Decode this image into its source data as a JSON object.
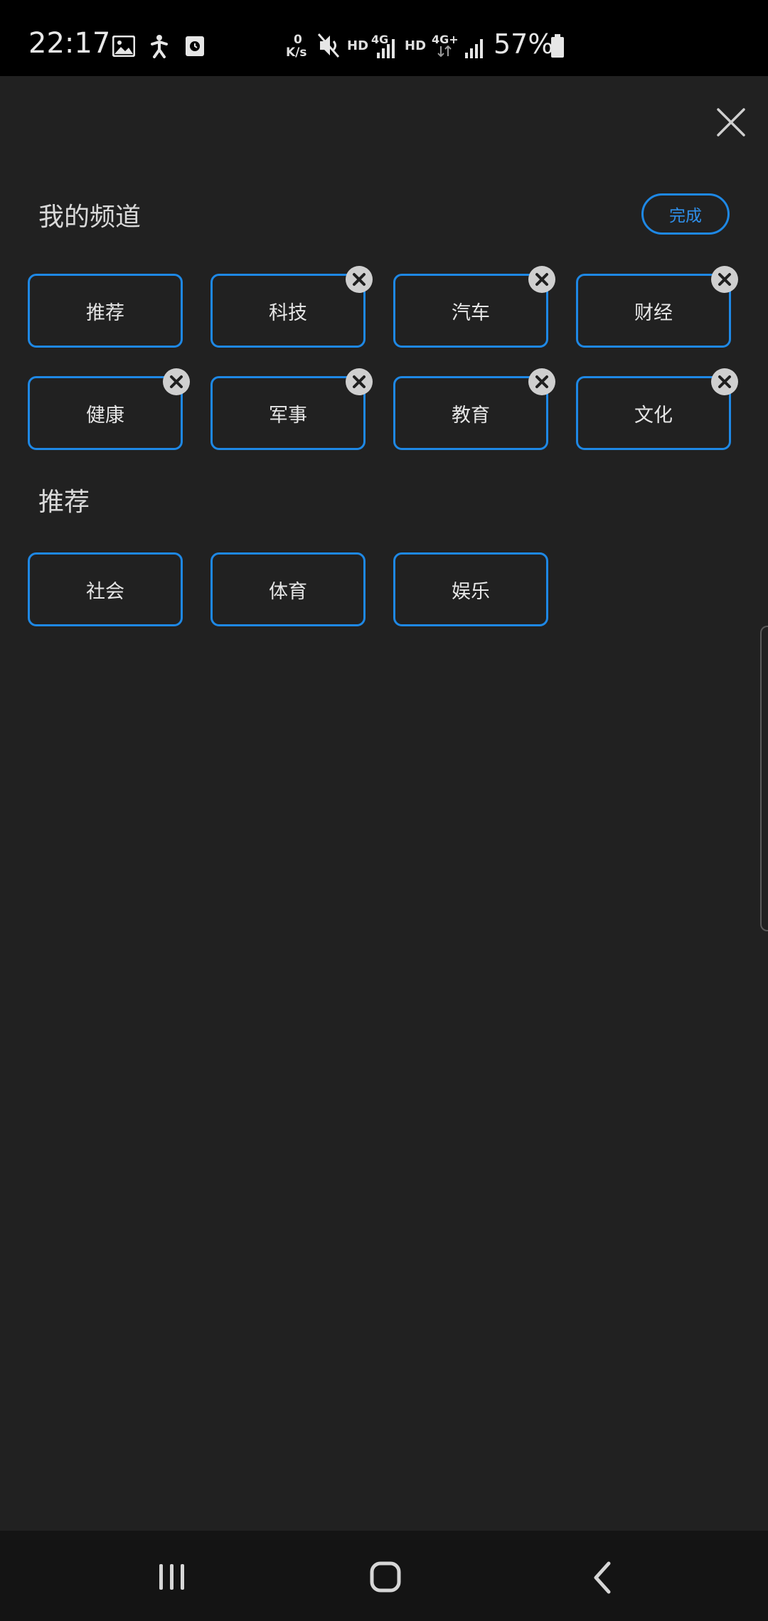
{
  "status_bar": {
    "time": "22:17",
    "net_speed_value": "0",
    "net_speed_unit": "K/s",
    "hd1": "HD",
    "network1": "4G",
    "hd2": "HD",
    "network2": "4G+",
    "battery": "57%",
    "icons": [
      "gallery-icon",
      "accessibility-icon",
      "recorder-icon",
      "mute-icon",
      "signal-icon",
      "signal-icon",
      "battery-icon"
    ]
  },
  "dialog": {
    "close_icon": "close-icon"
  },
  "my_channels": {
    "title": "我的频道",
    "done_label": "完成",
    "items": [
      {
        "label": "推荐",
        "removable": false
      },
      {
        "label": "科技",
        "removable": true
      },
      {
        "label": "汽车",
        "removable": true
      },
      {
        "label": "财经",
        "removable": true
      },
      {
        "label": "健康",
        "removable": true
      },
      {
        "label": "军事",
        "removable": true
      },
      {
        "label": "教育",
        "removable": true
      },
      {
        "label": "文化",
        "removable": true
      }
    ]
  },
  "recommended": {
    "title": "推荐",
    "items": [
      {
        "label": "社会"
      },
      {
        "label": "体育"
      },
      {
        "label": "娱乐"
      }
    ]
  },
  "nav_bar": {
    "icons": [
      "recents-icon",
      "home-icon",
      "back-icon"
    ]
  },
  "colors": {
    "accent": "#1e88e5",
    "background": "#212121",
    "badge": "#cfcfcf"
  }
}
